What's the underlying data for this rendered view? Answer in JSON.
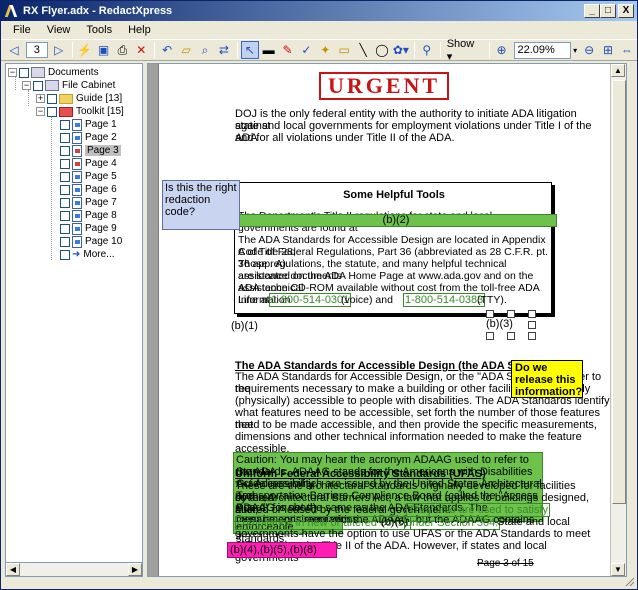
{
  "window": {
    "title": "RX Flyer.adx - RedactXpress",
    "controls": [
      "_",
      "□",
      "X"
    ]
  },
  "menu": [
    "File",
    "View",
    "Tools",
    "Help"
  ],
  "toolbar": {
    "page_number": "3",
    "show_label": "Show ▾",
    "zoom_value": "22.09%"
  },
  "tree": {
    "root": "Documents",
    "cabinet": "File Cabinet",
    "guide": "Guide [13]",
    "toolkit": "Toolkit [15]",
    "pages": [
      "Page 1",
      "Page 2",
      "Page 3",
      "Page 4",
      "Page 5",
      "Page 6",
      "Page 7",
      "Page 8",
      "Page 9",
      "Page 10"
    ],
    "selected_page": "Page 3",
    "more": "More..."
  },
  "document": {
    "header": "URGENT",
    "intro": [
      "DOJ is the only federal entity with the authority to initiate ADA litigation against",
      "state and local governments for employment violations under Title I of the ADA",
      "and for all violations under Title II of the ADA."
    ],
    "tools_title": "Some Helpful Tools",
    "tools_lines": [
      "The Department's Title II regulations for state and local governments are found at",
      "The ADA Standards for Accessible Design are located in Appendix A of Title 28,",
      "Code of Federal Regulations, Part 36 (abbreviated as 28 C.F.R. pt. 36 app. A).",
      "Those regulations, the statute, and many helpful technical assistance documents",
      "are located on the ADA Home Page at www.ada.gov and on the ADA technical",
      "assistance CD-ROM available without cost from the toll-free ADA Information"
    ],
    "info_line_start": "Line at",
    "phone_voice": "1-800-514-0301",
    "voice_label": "(voice) and",
    "phone_tty": "1-800-514-0383",
    "tty_label": "(TTY).",
    "standards_heading": "The ADA Standards for Accessible Design (the ADA Standards)",
    "standards_lines": [
      "The ADA Standards for Accessible Design, or the \"ADA Standards,\" refer to the",
      "requirements necessary to make a building or other facility architecturally",
      "(physically) accessible to people with disabilities.  The ADA Standards identify",
      "what features need to be accessible, set forth the number of those features that",
      "need to be made accessible, and then provide the specific measurements,",
      "dimensions and other technical information needed to make the feature",
      "accessible."
    ],
    "caution_lines": [
      "Caution: You may hear the acronym ADAAG used to refer to the ADA",
      "Standards.  ADAAG stands for the Americans with Disabilities Act Accessibility",
      "Guidelines, which are issued by the United States Architectural and",
      "Transportation Barriers Compliance Board (called the \"Access Board\" for short).",
      "ADAAG is not the same as the ADA Standards.  The Department's regulations",
      "must be consistent with the ADAAG, but the ADAAG contains guidelines, not",
      "enforceable standards."
    ],
    "ufas_heading": "Uniform Federal Accessibility Standards (UFAS)",
    "ufas_lines": [
      "These are the architectural standards originally developed for facilities covered",
      "by the Architectural Barriers Act, a law that applies to buildings designed, built,",
      "altered or leased by the federal government.",
      "governments have the option to use UFAS or the ADA Standards to meet their",
      "obligations under Title II of the ADA.  However, if states and local governments"
    ],
    "ufas_redacted_1": "They also are used to satisfy",
    "ufas_redacted_2": "compliance in new or altered consti",
    "ufas_redacted_2b": "under Section 504.",
    "ufas_after": "State and local",
    "page_footer": "Page 3 of 15"
  },
  "redactions": {
    "code_b2": "(b)(2)",
    "code_b1": "(b)(1)",
    "code_b3": "(b)(3)",
    "code_b6": "(b)(6)",
    "code_multi": "(b)(4),(b)(5),(b)(8)"
  },
  "notes": {
    "blue": "Is this the right redaction code?",
    "yellow": "Do we release this information?"
  }
}
